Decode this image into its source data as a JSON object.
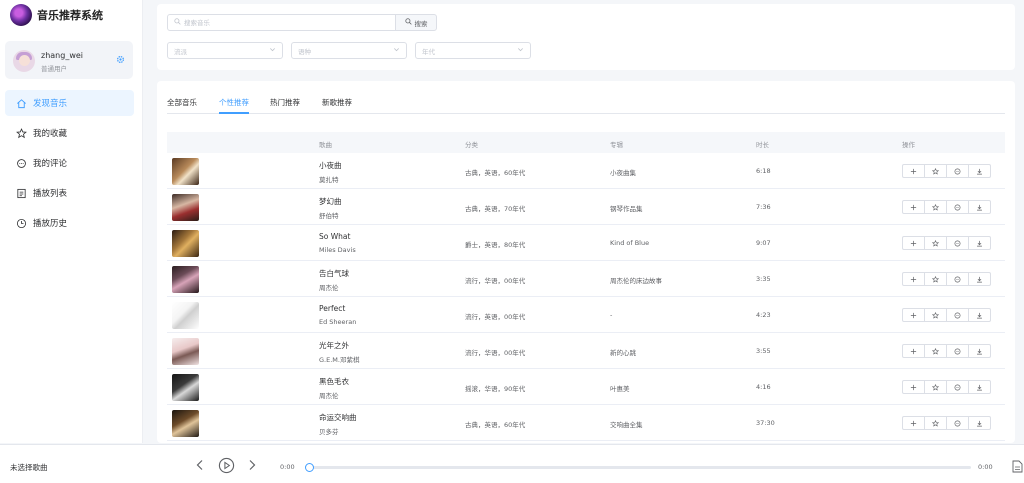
{
  "app": {
    "title": "音乐推荐系统"
  },
  "user": {
    "name": "zhang_wei",
    "role": "普通用户"
  },
  "nav": [
    {
      "label": "发现音乐",
      "icon": "home-icon",
      "active": true
    },
    {
      "label": "我的收藏",
      "icon": "star-icon",
      "active": false
    },
    {
      "label": "我的评论",
      "icon": "comment-icon",
      "active": false
    },
    {
      "label": "播放列表",
      "icon": "playlist-icon",
      "active": false
    },
    {
      "label": "播放历史",
      "icon": "clock-icon",
      "active": false
    }
  ],
  "search": {
    "placeholder": "搜索音乐",
    "button": "搜索"
  },
  "filters": [
    {
      "placeholder": "流派"
    },
    {
      "placeholder": "语种"
    },
    {
      "placeholder": "年代"
    }
  ],
  "tabs": [
    {
      "label": "全部音乐",
      "active": false
    },
    {
      "label": "个性推荐",
      "active": true
    },
    {
      "label": "热门推荐",
      "active": false
    },
    {
      "label": "新歌推荐",
      "active": false
    }
  ],
  "columns": {
    "song": "歌曲",
    "category": "分类",
    "album": "专辑",
    "duration": "时长",
    "actions": "操作"
  },
  "songs": [
    {
      "title": "小夜曲",
      "artist": "莫扎特",
      "category": "古典，英语，60年代",
      "album": "小夜曲集",
      "duration": "6:18"
    },
    {
      "title": "梦幻曲",
      "artist": "舒伯特",
      "category": "古典，英语，70年代",
      "album": "钢琴作品集",
      "duration": "7:36"
    },
    {
      "title": "So What",
      "artist": "Miles Davis",
      "category": "爵士，英语，80年代",
      "album": "Kind of Blue",
      "duration": "9:07"
    },
    {
      "title": "告白气球",
      "artist": "周杰伦",
      "category": "流行，华语，00年代",
      "album": "周杰伦的床边故事",
      "duration": "3:35"
    },
    {
      "title": "Perfect",
      "artist": "Ed Sheeran",
      "category": "流行，英语，00年代",
      "album": "-",
      "duration": "4:23"
    },
    {
      "title": "光年之外",
      "artist": "G.E.M.邓紫棋",
      "category": "流行，华语，00年代",
      "album": "新的心跳",
      "duration": "3:55"
    },
    {
      "title": "黑色毛衣",
      "artist": "周杰伦",
      "category": "摇滚，华语，90年代",
      "album": "叶惠美",
      "duration": "4:16"
    },
    {
      "title": "命运交响曲",
      "artist": "贝多芬",
      "category": "古典，英语，60年代",
      "album": "交响曲全集",
      "duration": "37:30"
    }
  ],
  "player": {
    "now_playing": "未选择歌曲",
    "current_time": "0:00",
    "total_time": "0:00",
    "progress": 0
  },
  "colors": {
    "accent": "#409eff",
    "active_bg": "#ecf5ff"
  }
}
